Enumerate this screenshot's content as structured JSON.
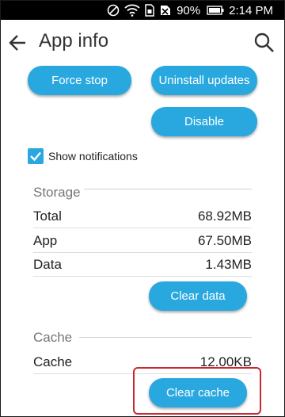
{
  "status_bar": {
    "battery_percent": "90%",
    "time": "2:14 PM",
    "icons": [
      "do-not-disturb-icon",
      "wifi-icon",
      "sim-card-icon",
      "no-sim-icon",
      "battery-icon"
    ]
  },
  "app_bar": {
    "title": "App info",
    "back_icon": "arrow-back-icon",
    "search_icon": "search-icon"
  },
  "actions": {
    "force_stop": "Force stop",
    "uninstall_updates": "Uninstall updates",
    "disable": "Disable"
  },
  "notifications": {
    "label": "Show notifications",
    "checked": true
  },
  "storage": {
    "header": "Storage",
    "rows": [
      {
        "label": "Total",
        "value": "68.92MB"
      },
      {
        "label": "App",
        "value": "67.50MB"
      },
      {
        "label": "Data",
        "value": "1.43MB"
      }
    ],
    "clear_button": "Clear data"
  },
  "cache": {
    "header": "Cache",
    "rows": [
      {
        "label": "Cache",
        "value": "12.00KB"
      }
    ],
    "clear_button": "Clear cache"
  },
  "colors": {
    "accent": "#29a8e0",
    "highlight": "#c8282f",
    "status_bar": "#000000"
  }
}
